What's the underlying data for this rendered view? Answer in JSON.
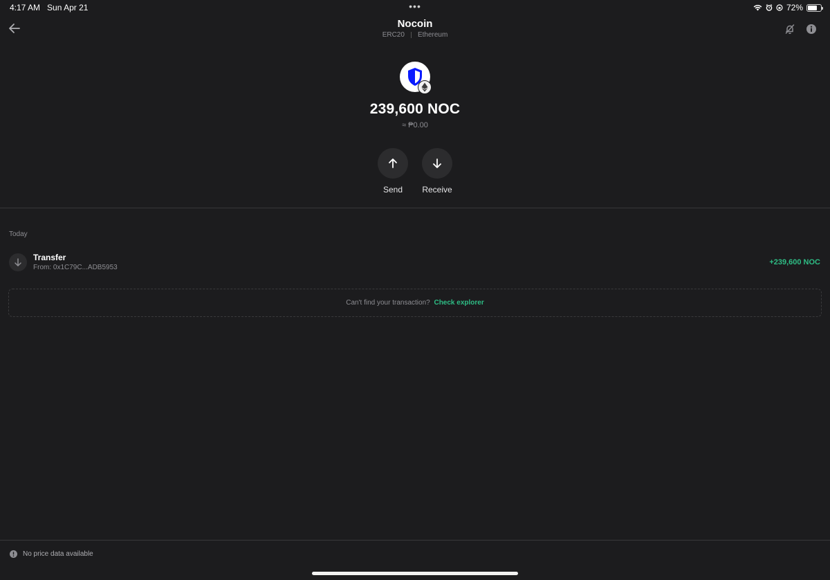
{
  "status_bar": {
    "time": "4:17 AM",
    "date": "Sun Apr 21",
    "battery": "72%",
    "battery_level": 0.72
  },
  "header": {
    "title": "Nocoin",
    "standard": "ERC20",
    "network": "Ethereum"
  },
  "token": {
    "balance": "239,600 NOC",
    "fiat_value": "≈ ₱0.00"
  },
  "actions": {
    "send_label": "Send",
    "receive_label": "Receive"
  },
  "history": {
    "section_label": "Today",
    "transactions": [
      {
        "type": "Transfer",
        "from": "From: 0x1C79C...ADB5953",
        "amount": "+239,600 NOC"
      }
    ],
    "explorer_prompt": "Can't find your transaction?",
    "explorer_link": "Check explorer"
  },
  "footer": {
    "note": "No price data available"
  },
  "colors": {
    "background": "#1c1c1e",
    "accent_green": "#2ebd85",
    "token_blue": "#0500ff"
  },
  "icons": {
    "back": "arrow-left-icon",
    "notifications": "bell-off-icon",
    "info": "info-icon",
    "token_logo": "shield-logo-icon",
    "chain_badge": "ethereum-icon",
    "send": "arrow-up-icon",
    "receive": "arrow-down-icon",
    "footer_note": "alert-circle-icon"
  }
}
